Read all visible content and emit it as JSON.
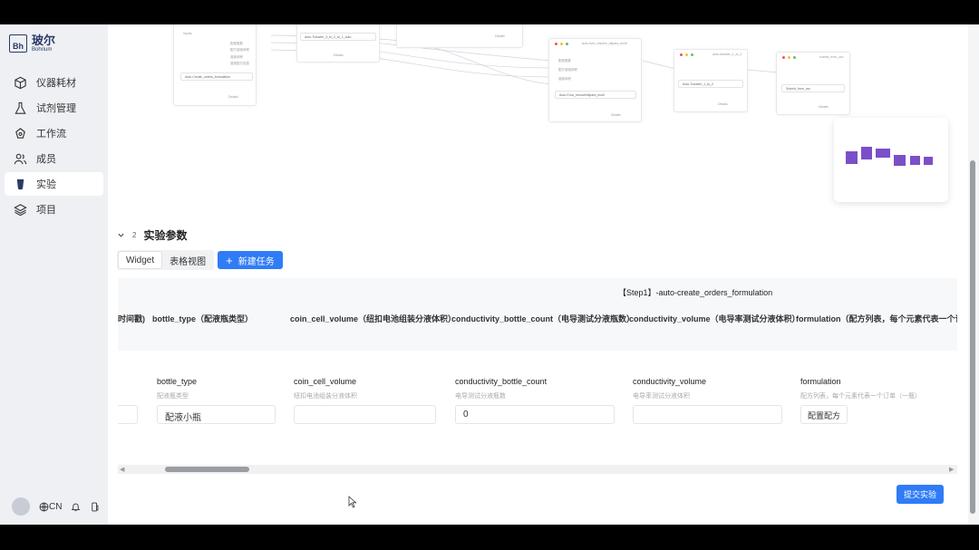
{
  "brand": {
    "mark": "Bh",
    "name_cn": "玻尔",
    "name_en": "Bohrium"
  },
  "sidebar": {
    "items": [
      {
        "label": "仪器耗材",
        "icon": "cube-icon"
      },
      {
        "label": "试剂管理",
        "icon": "flask-icon"
      },
      {
        "label": "工作流",
        "icon": "workflow-icon"
      },
      {
        "label": "成员",
        "icon": "users-icon"
      },
      {
        "label": "实验",
        "icon": "beaker-icon",
        "active": true
      },
      {
        "label": "项目",
        "icon": "layers-icon"
      }
    ],
    "language": "CN"
  },
  "canvas": {
    "nodes": [
      {
        "title": "",
        "pill": "Auto-Create_orders_formulation",
        "rows": [
          "配液瓶数",
          "配方溶液体积",
          "溶液体积",
          "溶液配方信息"
        ]
      },
      {
        "title": "",
        "pill": "Auto-Transfer_3_to_2_to_1_auto",
        "rows": []
      },
      {
        "title": "auto-func_resolve_allpara_multi",
        "pill": "Auto-Func_resolveAllpara_multi",
        "rows": [
          "配液瓶数",
          "配方溶液体积",
          "溶液体积"
        ]
      },
      {
        "title": "auto-transfer_1_to_2",
        "pill": "Auto-Transfer_1_to_2",
        "rows": []
      },
      {
        "title": "submit_from_csv",
        "pill": "Submit_from_csv",
        "rows": []
      }
    ]
  },
  "section": {
    "number": "2",
    "title": "实验参数"
  },
  "tabs": {
    "widget": "Widget",
    "table_view": "表格视图",
    "new_task": "新建任务"
  },
  "table": {
    "step_title": "【Step1】-auto-create_orders_formulation",
    "columns": [
      {
        "header": "时间戳)"
      },
      {
        "header": "bottle_type（配液瓶类型）",
        "label": "bottle_type",
        "hint": "配液瓶类型",
        "value": "配液小瓶"
      },
      {
        "header": "coin_cell_volume（纽扣电池组装分液体积）",
        "label": "coin_cell_volume",
        "hint": "纽扣电池组装分液体积",
        "value": ""
      },
      {
        "header": "conductivity_bottle_count（电导测试分液瓶数）",
        "label": "conductivity_bottle_count",
        "hint": "电导测试分液瓶数",
        "value": "0"
      },
      {
        "header": "conductivity_volume（电导率测试分液体积）",
        "label": "conductivity_volume",
        "hint": "电导率测试分液体积",
        "value": ""
      },
      {
        "header": "formulation（配方列表，每个元素代表一个订",
        "label": "formulation",
        "hint": "配方列表，每个元素代表一个订单（一瓶）",
        "button": "配置配方"
      }
    ]
  },
  "submit_label": "提交实验",
  "colors": {
    "accent": "#2f7cf6",
    "minimap": "#7b4fc9"
  }
}
